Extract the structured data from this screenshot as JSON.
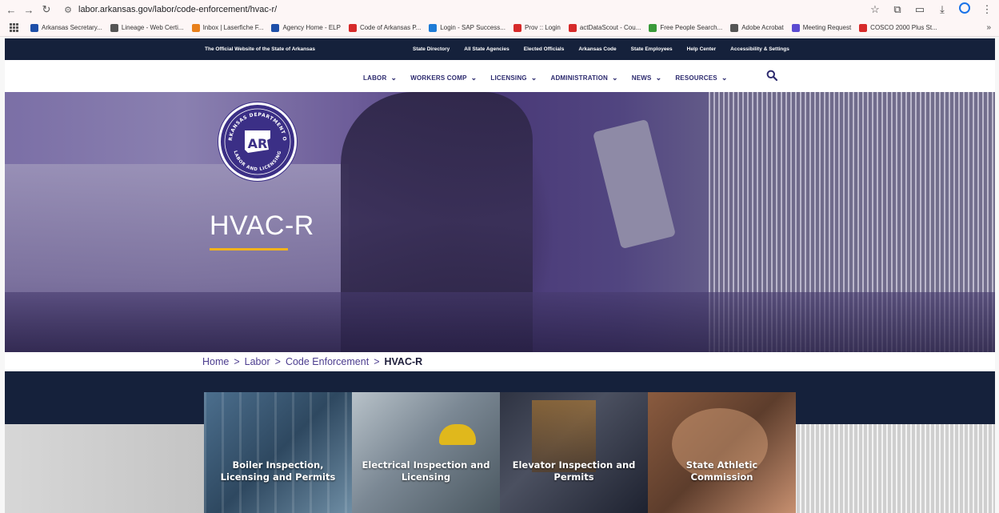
{
  "browser": {
    "url": "labor.arkansas.gov/labor/code-enforcement/hvac-r/",
    "bookmarks": [
      {
        "label": "Arkansas Secretary...",
        "color": "#1e4fa8"
      },
      {
        "label": "Lineage - Web Certi...",
        "color": "#555555"
      },
      {
        "label": "Inbox | Laserfiche F...",
        "color": "#e8801c"
      },
      {
        "label": "Agency Home - ELP",
        "color": "#1e4fa8"
      },
      {
        "label": "Code of Arkansas P...",
        "color": "#d62a2a"
      },
      {
        "label": "Login - SAP Success...",
        "color": "#1e7bd6"
      },
      {
        "label": "Prov :: Login",
        "color": "#d62a2a"
      },
      {
        "label": "actDataScout - Cou...",
        "color": "#d62a2a"
      },
      {
        "label": "Free People Search...",
        "color": "#3a9a3a"
      },
      {
        "label": "Adobe Acrobat",
        "color": "#555555"
      },
      {
        "label": "Meeting Request",
        "color": "#5b4bd1"
      },
      {
        "label": "COSCO 2000 Plus St...",
        "color": "#d62a2a"
      }
    ],
    "more": "»"
  },
  "utility": {
    "official": "The Official Website of the State of Arkansas",
    "links": [
      "State Directory",
      "All State Agencies",
      "Elected Officials",
      "Arkansas Code",
      "State Employees",
      "Help Center",
      "Accessibility & Settings"
    ]
  },
  "nav": {
    "items": [
      "LABOR",
      "WORKERS COMP",
      "LICENSING",
      "ADMINISTRATION",
      "NEWS",
      "RESOURCES"
    ]
  },
  "seal": {
    "text_top": "ARKANSAS DEPARTMENT OF",
    "text_bottom": "LABOR AND LICENSING",
    "mark": "AR"
  },
  "hero": {
    "title": "HVAC-R",
    "accent": "#f2b31c"
  },
  "breadcrumb": {
    "items": [
      "Home",
      "Labor",
      "Code Enforcement"
    ],
    "separator": ">",
    "current": "HVAC-R"
  },
  "cards": [
    {
      "label": "Boiler Inspection, Licensing and Permits"
    },
    {
      "label": "Electrical Inspection and Licensing"
    },
    {
      "label": "Elevator Inspection and Permits"
    },
    {
      "label": "State Athletic Commission"
    }
  ],
  "colors": {
    "navy": "#15213b",
    "purple": "#3b2f86",
    "nav_text": "#2c2a6e"
  }
}
